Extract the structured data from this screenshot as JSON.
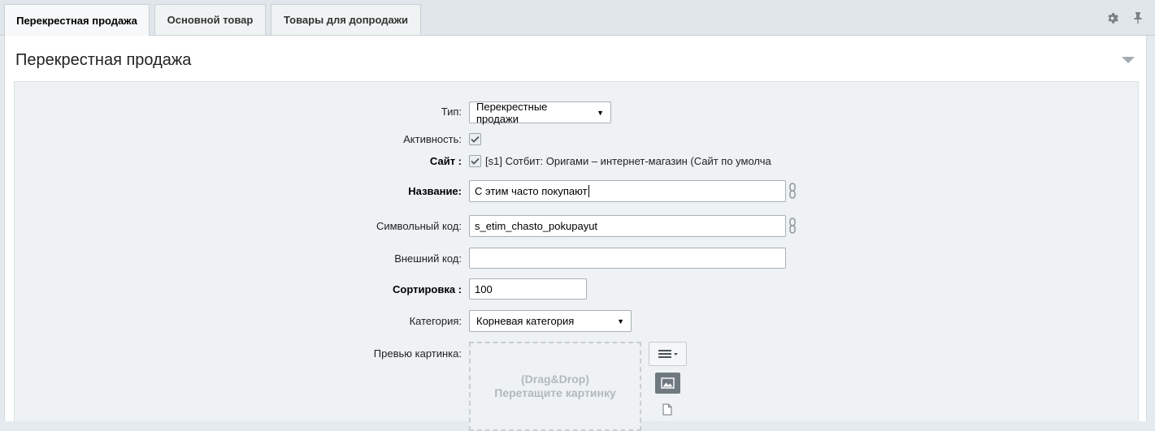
{
  "tabs": [
    {
      "label": "Перекрестная продажа",
      "active": true
    },
    {
      "label": "Основной товар",
      "active": false
    },
    {
      "label": "Товары для допродажи",
      "active": false
    }
  ],
  "tab_tools": {
    "settings_icon": "gear-icon",
    "pin_icon": "pin-icon"
  },
  "section": {
    "title": "Перекрестная продажа"
  },
  "form": {
    "type": {
      "label": "Тип:",
      "value": "Перекрестные продажи"
    },
    "active": {
      "label": "Активность:",
      "checked": true
    },
    "site": {
      "label": "Сайт :",
      "checked": true,
      "value": "[s1] Сотбит: Оригами – интернет-магазин (Сайт по умолча"
    },
    "name": {
      "label": "Название:",
      "value": "С этим часто покупают"
    },
    "code": {
      "label": "Символьный код:",
      "value": "s_etim_chasto_pokupayut"
    },
    "external_code": {
      "label": "Внешний код:",
      "value": ""
    },
    "sort": {
      "label": "Сортировка :",
      "value": "100"
    },
    "category": {
      "label": "Категория:",
      "value": "Корневая категория"
    },
    "preview": {
      "label": "Превью картинка:",
      "dropzone_line1": "(Drag&Drop)",
      "dropzone_line2": "Перетащите картинку"
    }
  },
  "colors": {
    "background": "#e4eaed",
    "panel": "#ffffff",
    "form_area": "#eef2f4",
    "border": "#a6b1b5"
  }
}
